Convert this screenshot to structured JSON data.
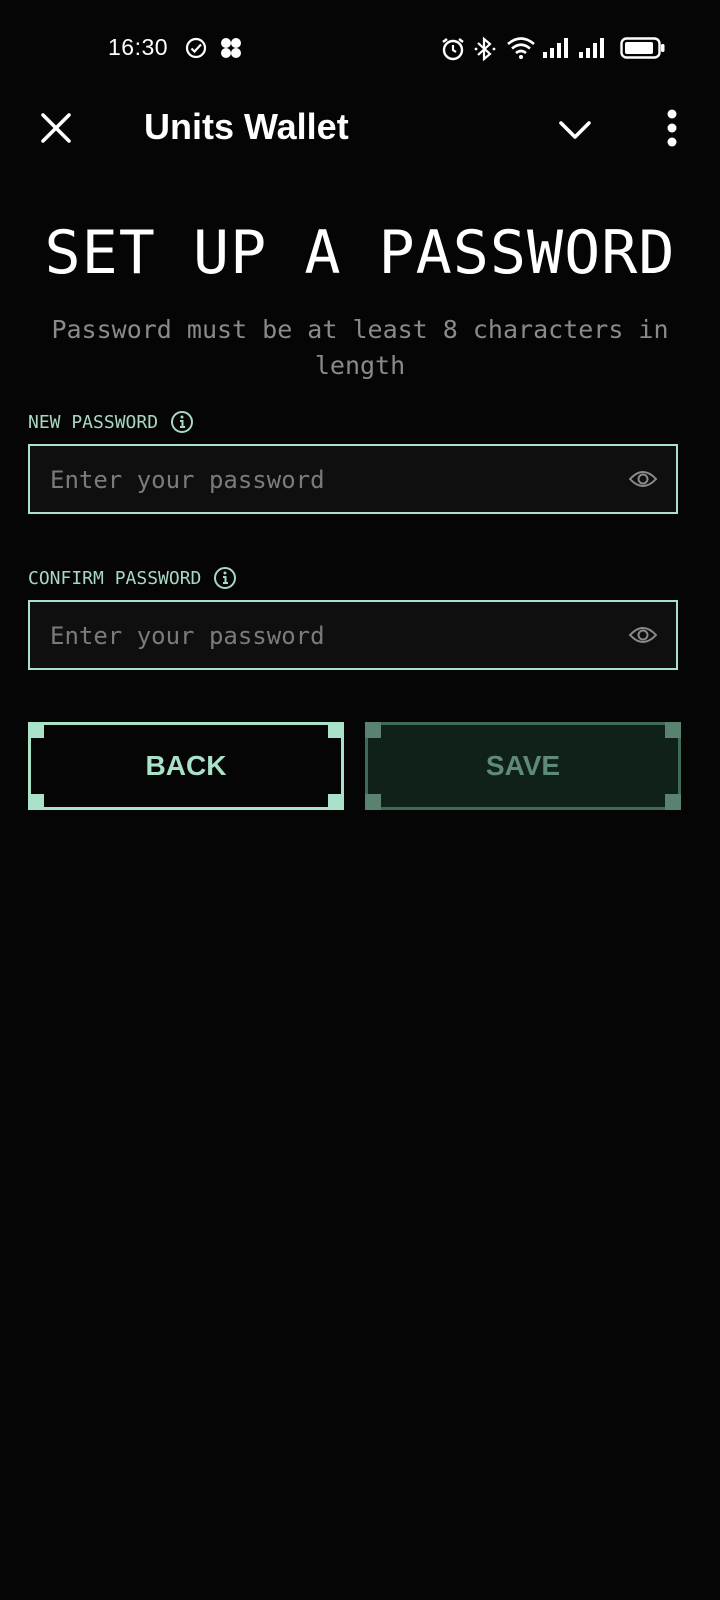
{
  "status_bar": {
    "time": "16:30",
    "icons": [
      "check-circle-icon",
      "app-notification-icon",
      "alarm-icon",
      "bluetooth-icon",
      "wifi-icon",
      "signal-icon",
      "signal-icon",
      "battery-icon"
    ]
  },
  "app_bar": {
    "title": "Units Wallet",
    "close_icon": "close-icon",
    "chevron_icon": "chevron-down-icon",
    "more_icon": "more-vertical-icon"
  },
  "page": {
    "heading": "SET UP A PASSWORD",
    "subtitle": "Password must be at least 8 characters in length"
  },
  "new_password": {
    "label": "NEW PASSWORD",
    "placeholder": "Enter your password",
    "value": ""
  },
  "confirm_password": {
    "label": "CONFIRM PASSWORD",
    "placeholder": "Enter your password",
    "value": ""
  },
  "buttons": {
    "back": "BACK",
    "save": "SAVE"
  },
  "colors": {
    "background": "#050505",
    "accent": "#a9e2c8",
    "save_bg": "#0f2119",
    "save_text": "#5e8a76",
    "muted_text": "#8a8a8a"
  }
}
